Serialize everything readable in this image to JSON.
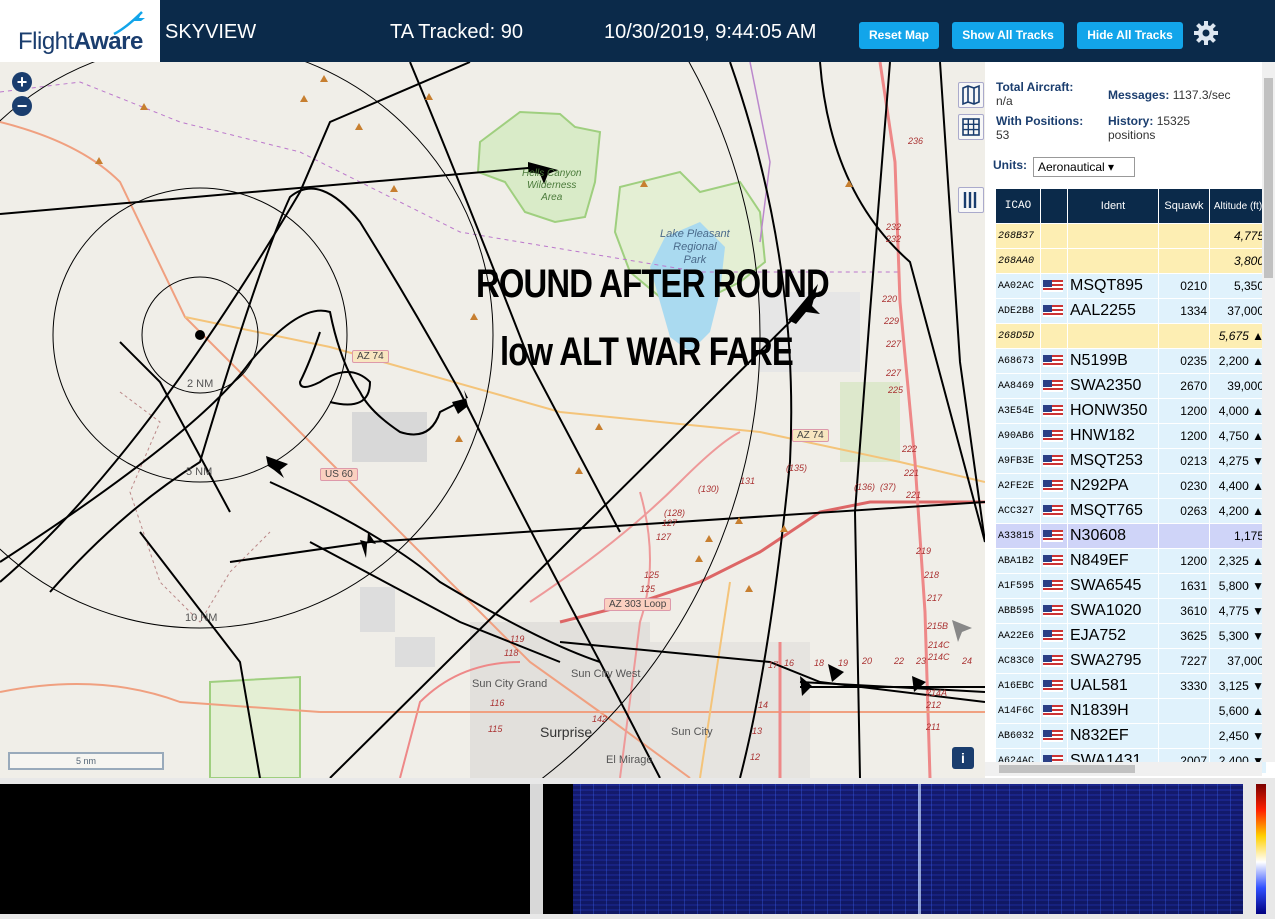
{
  "header": {
    "logo_text_a": "Flight",
    "logo_text_b": "Aware",
    "app_title": "SKYVIEW",
    "ta_tracked": "TA Tracked: 90",
    "clock": "10/30/2019, 9:44:05 AM",
    "reset_label": "Reset Map",
    "show_label": "Show All Tracks",
    "hide_label": "Hide All Tracks",
    "settings_icon": "gear-icon",
    "brand_color": "#0b2a4a",
    "button_color": "#12a5ea"
  },
  "map": {
    "overlay_line1": "ROUND AFTER ROUND",
    "overlay_line2": "low ALT WAR FARE",
    "zoom_in": "+",
    "zoom_out": "−",
    "scale": "5 nm",
    "info": "i",
    "rings": [
      "2 NM",
      "5 NM",
      "10 NM"
    ],
    "places": {
      "wilderness": "Hells Canyon\nWilderness\nArea",
      "lake": "Lake Pleasant\nRegional\nPark",
      "sun_city_grand": "Sun City Grand",
      "sun_city_west": "Sun City West",
      "surprise": "Surprise",
      "sun_city": "Sun City",
      "el_mirage": "El Mirage"
    },
    "shields": {
      "az74a": "AZ 74",
      "az74b": "AZ 74",
      "us60": "US 60",
      "az303": "AZ 303 Loop"
    },
    "road_numbers": [
      "236",
      "232",
      "232",
      "220",
      "229",
      "227",
      "227",
      "225",
      "222",
      "221",
      "221",
      "219",
      "218",
      "217",
      "215B",
      "214C",
      "214C",
      "214A",
      "212",
      "211",
      "(135)",
      "(136)",
      "(37)",
      "(130)",
      "131",
      "(128)",
      "127",
      "127",
      "125",
      "125",
      "119",
      "118",
      "116",
      "115",
      "142",
      "17",
      "16",
      "18",
      "19",
      "20",
      "22",
      "23",
      "24",
      "14",
      "13",
      "12"
    ]
  },
  "panel": {
    "total_label": "Total Aircraft:",
    "total_value": "n/a",
    "with_pos_label": "With Positions:",
    "with_pos_value": "53",
    "messages_label": "Messages:",
    "messages_value": "1137.3/sec",
    "history_label": "History:",
    "history_value": "15325",
    "history_unit": "positions",
    "units_label": "Units:",
    "units_value": "Aeronautical ▾",
    "columns": {
      "icao": "ICAO",
      "ident": "Ident",
      "squawk": "Squawk",
      "altitude": "Altitude (ft)"
    },
    "rows": [
      {
        "icao": "268B37",
        "ident": "",
        "squawk": "",
        "alt": "4,775",
        "style": "stale",
        "flag": false
      },
      {
        "icao": "268AA0",
        "ident": "",
        "squawk": "",
        "alt": "3,800",
        "style": "stale",
        "flag": false
      },
      {
        "icao": "AA02AC",
        "ident": "MSQT895",
        "squawk": "0210",
        "alt": "5,350",
        "style": "norm",
        "flag": true
      },
      {
        "icao": "ADE2B8",
        "ident": "AAL2255",
        "squawk": "1334",
        "alt": "37,000",
        "style": "norm",
        "flag": true
      },
      {
        "icao": "268D5D",
        "ident": "",
        "squawk": "",
        "alt": "5,675 ▲",
        "style": "stale",
        "flag": false
      },
      {
        "icao": "A68673",
        "ident": "N5199B",
        "squawk": "0235",
        "alt": "2,200 ▲",
        "style": "norm",
        "flag": true
      },
      {
        "icao": "AA8469",
        "ident": "SWA2350",
        "squawk": "2670",
        "alt": "39,000",
        "style": "norm",
        "flag": true
      },
      {
        "icao": "A3E54E",
        "ident": "HONW350",
        "squawk": "1200",
        "alt": "4,000 ▲",
        "style": "norm",
        "flag": true
      },
      {
        "icao": "A90AB6",
        "ident": "HNW182",
        "squawk": "1200",
        "alt": "4,750 ▲",
        "style": "norm",
        "flag": true
      },
      {
        "icao": "A9FB3E",
        "ident": "MSQT253",
        "squawk": "0213",
        "alt": "4,275 ▼",
        "style": "norm",
        "flag": true
      },
      {
        "icao": "A2FE2E",
        "ident": "N292PA",
        "squawk": "0230",
        "alt": "4,400 ▲",
        "style": "norm",
        "flag": true
      },
      {
        "icao": "ACC327",
        "ident": "MSQT765",
        "squawk": "0263",
        "alt": "4,200 ▲",
        "style": "norm",
        "flag": true
      },
      {
        "icao": "A33815",
        "ident": "N30608",
        "squawk": "",
        "alt": "1,175",
        "style": "sel",
        "flag": true
      },
      {
        "icao": "ABA1B2",
        "ident": "N849EF",
        "squawk": "1200",
        "alt": "2,325 ▲",
        "style": "norm",
        "flag": true
      },
      {
        "icao": "A1F595",
        "ident": "SWA6545",
        "squawk": "1631",
        "alt": "5,800 ▼",
        "style": "norm",
        "flag": true
      },
      {
        "icao": "ABB595",
        "ident": "SWA1020",
        "squawk": "3610",
        "alt": "4,775 ▼",
        "style": "norm",
        "flag": true
      },
      {
        "icao": "AA22E6",
        "ident": "EJA752",
        "squawk": "3625",
        "alt": "5,300 ▼",
        "style": "norm",
        "flag": true
      },
      {
        "icao": "AC83C0",
        "ident": "SWA2795",
        "squawk": "7227",
        "alt": "37,000",
        "style": "norm",
        "flag": true
      },
      {
        "icao": "A16EBC",
        "ident": "UAL581",
        "squawk": "3330",
        "alt": "3,125 ▼",
        "style": "norm",
        "flag": true
      },
      {
        "icao": "A14F6C",
        "ident": "N1839H",
        "squawk": "",
        "alt": "5,600 ▲",
        "style": "norm",
        "flag": true
      },
      {
        "icao": "AB6032",
        "ident": "N832EF",
        "squawk": "",
        "alt": "2,450 ▼",
        "style": "norm",
        "flag": true
      },
      {
        "icao": "A624AC",
        "ident": "SWA1431",
        "squawk": "2007",
        "alt": "2,400 ▼",
        "style": "norm",
        "flag": true
      }
    ]
  }
}
